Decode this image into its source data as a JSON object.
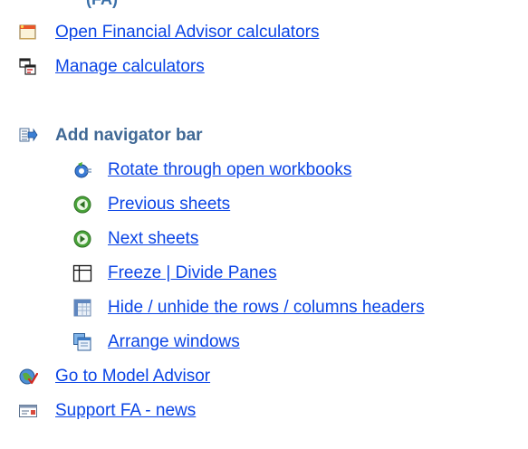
{
  "section_partial_heading": "(FA)",
  "items": [
    {
      "label": "Open Financial Advisor calculators",
      "icon": "calculator-window-icon"
    },
    {
      "label": "Manage calculators",
      "icon": "manage-windows-icon"
    }
  ],
  "navigator": {
    "heading": "Add navigator bar",
    "icon": "add-navigator-bar-icon",
    "subitems": [
      {
        "label": "Rotate through open workbooks",
        "icon": "rotate-workbooks-icon"
      },
      {
        "label": "Previous sheets",
        "icon": "previous-arrow-icon"
      },
      {
        "label": "Next sheets",
        "icon": "next-arrow-icon"
      },
      {
        "label": "Freeze | Divide Panes",
        "icon": "freeze-panes-icon"
      },
      {
        "label": "Hide / unhide the rows / columns headers",
        "icon": "headers-grid-icon"
      },
      {
        "label": "Arrange windows",
        "icon": "arrange-windows-icon"
      }
    ]
  },
  "bottom_items": [
    {
      "label": "Go to Model Advisor",
      "icon": "model-advisor-icon"
    },
    {
      "label": "Support FA - news",
      "icon": "support-news-icon"
    }
  ],
  "colors": {
    "link": "#0b45e6",
    "heading": "#3f6895"
  }
}
